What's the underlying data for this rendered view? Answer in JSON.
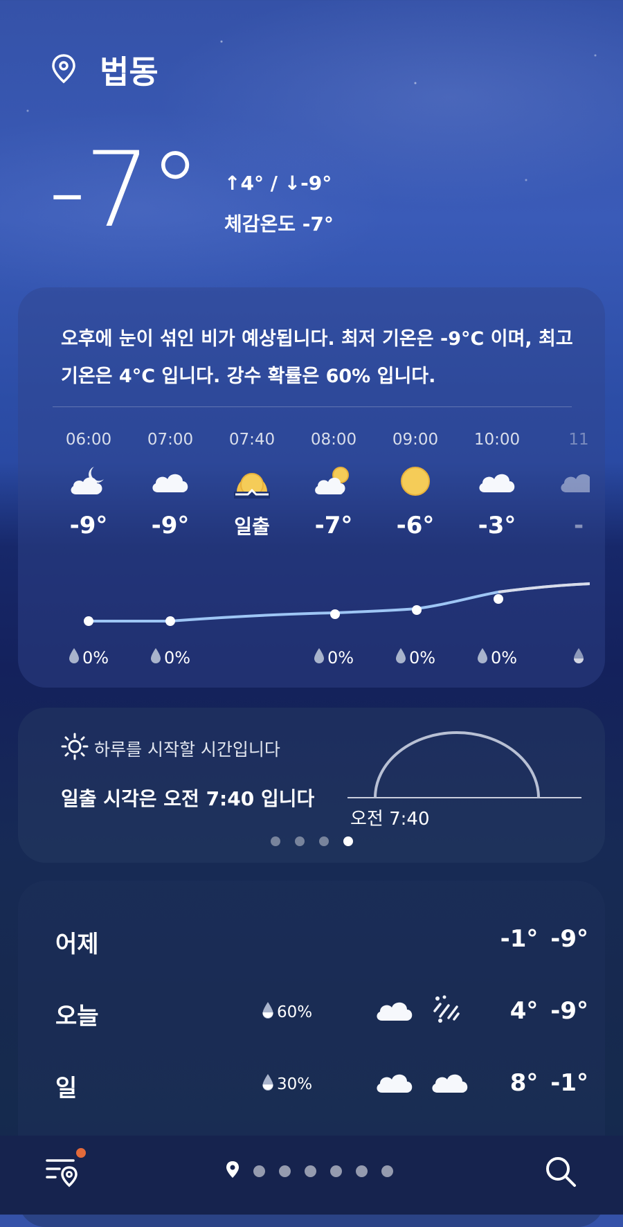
{
  "location": {
    "name": "법동",
    "icon": "map-pin-icon"
  },
  "current": {
    "temp": "-7°",
    "hi_lo": "↑4° / ↓-9°",
    "feels_like": "체감온도 -7°"
  },
  "summary": "오후에 눈이 섞인 비가 예상됩니다. 최저 기온은 -9°C 이며, 최고 기온은 4°C 입니다. 강수 확률은 60% 입니다.",
  "hourly": [
    {
      "time": "06:00",
      "icon": "partly-cloudy-night-icon",
      "temp": "-9°",
      "precip": "0%"
    },
    {
      "time": "07:00",
      "icon": "cloudy-icon",
      "temp": "-9°",
      "precip": "0%"
    },
    {
      "time": "07:40",
      "icon": "sunrise-icon",
      "temp": "일출",
      "precip": ""
    },
    {
      "time": "08:00",
      "icon": "partly-cloudy-day-icon",
      "temp": "-7°",
      "precip": "0%"
    },
    {
      "time": "09:00",
      "icon": "sunny-icon",
      "temp": "-6°",
      "precip": "0%"
    },
    {
      "time": "10:00",
      "icon": "cloudy-icon",
      "temp": "-3°",
      "precip": "0%"
    },
    {
      "time": "11",
      "icon": "cloudy-icon",
      "temp": "-",
      "precip": ""
    }
  ],
  "sunrise_card": {
    "subtitle": "하루를 시작할 시간입니다",
    "title": "일출 시각은 오전 7:40 입니다",
    "time": "오전 7:40",
    "page_count": 4,
    "active_page": 4
  },
  "daily": [
    {
      "day": "어제",
      "precip": "",
      "icon_am": "",
      "icon_pm": "",
      "temps": "-1° -9°"
    },
    {
      "day": "오늘",
      "precip": "60%",
      "icon_am": "cloudy-icon",
      "icon_pm": "snow-rain-icon",
      "temps": "4° -9°"
    },
    {
      "day": "일",
      "precip": "30%",
      "icon_am": "cloudy-icon",
      "icon_pm": "cloudy-icon",
      "temps": "8°  -1°"
    }
  ],
  "bottom_bar": {
    "menu_icon": "location-list-icon",
    "search_icon": "search-icon",
    "location_pages": 6
  },
  "colors": {
    "accent_badge": "#e36a3a",
    "curve": "#9ec6f5",
    "sun_yellow": "#f5cc58"
  }
}
